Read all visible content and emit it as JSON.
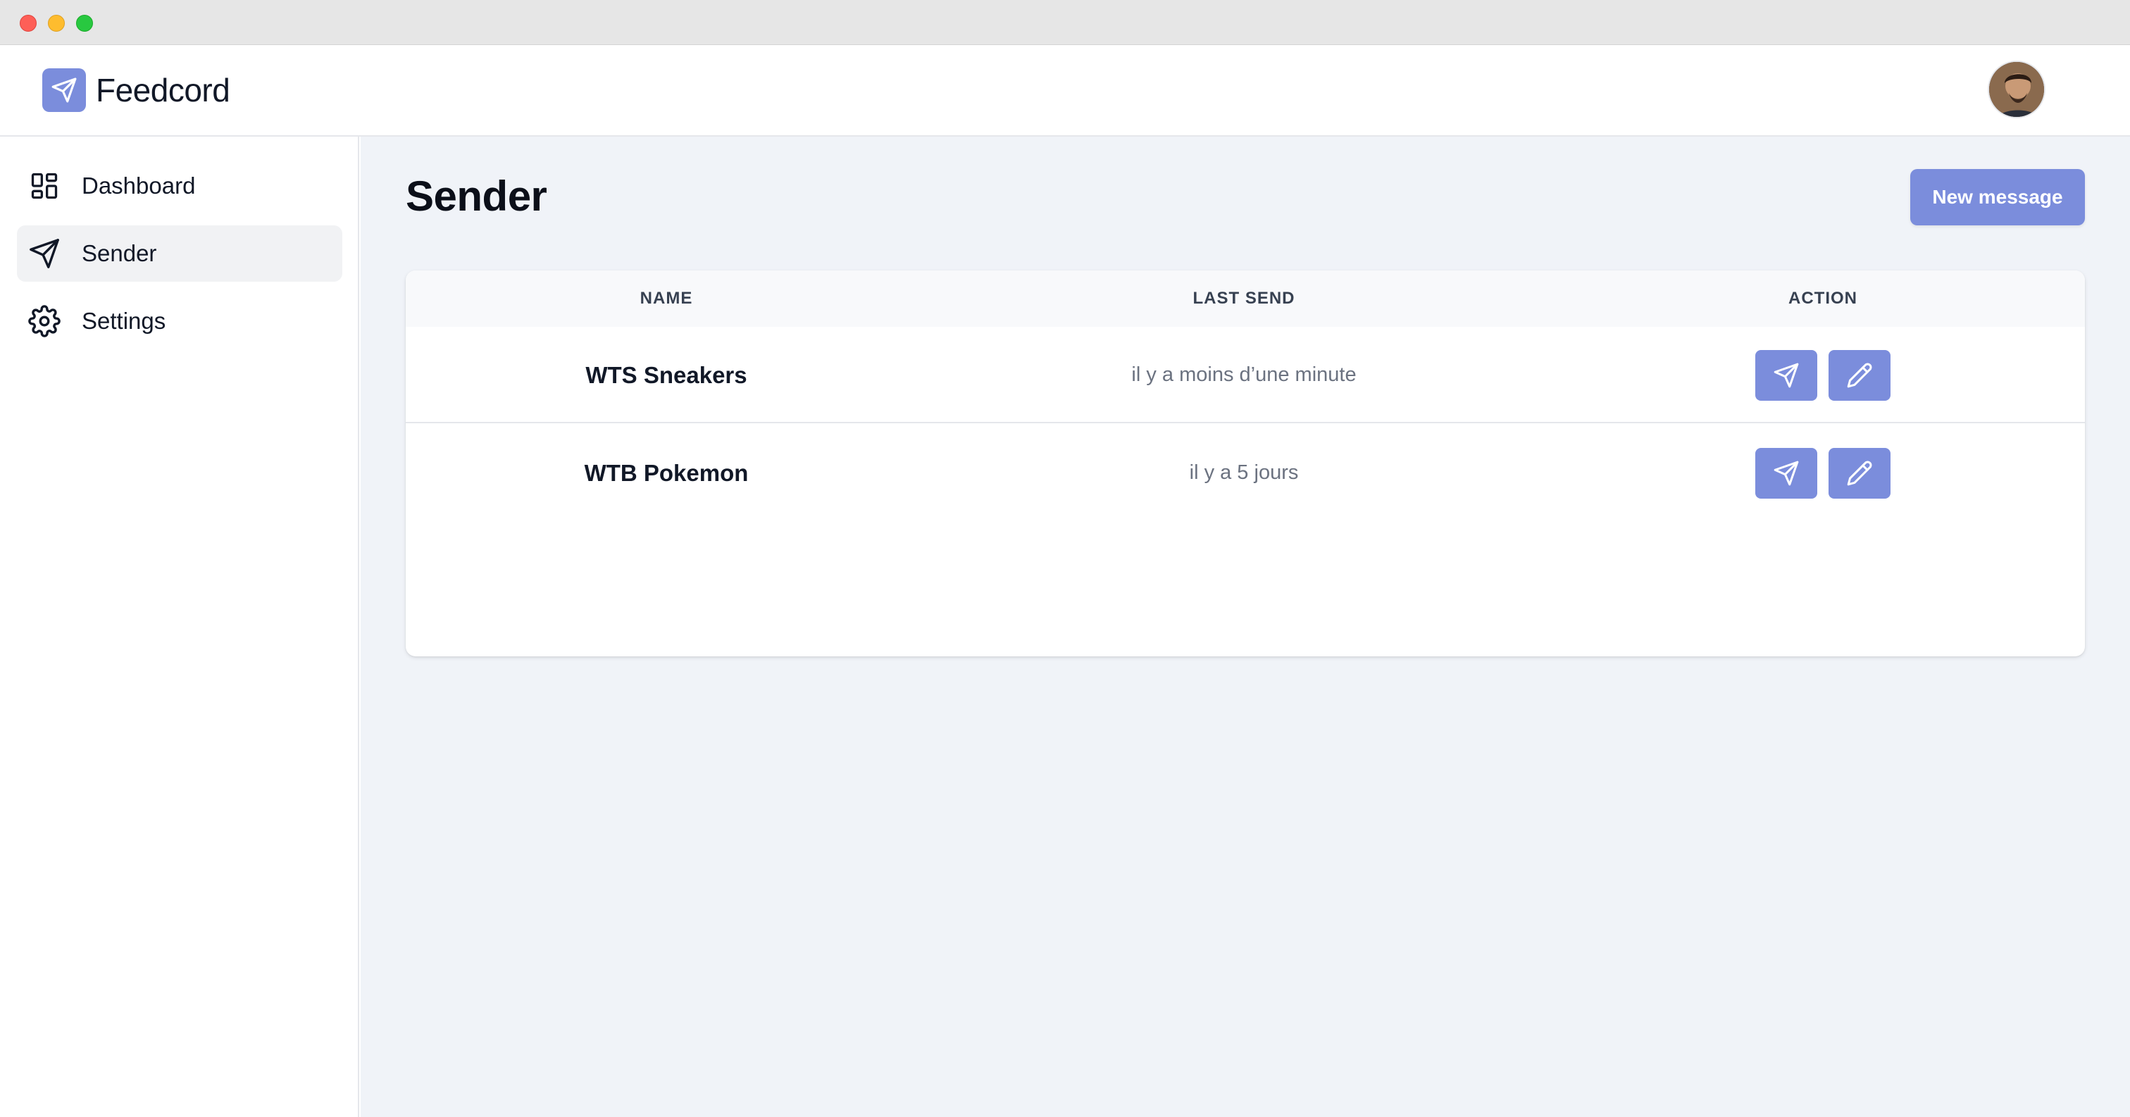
{
  "window": {
    "controls": [
      "close",
      "minimize",
      "maximize"
    ]
  },
  "header": {
    "brand_name": "Feedcord",
    "brand_icon": "paper-plane-icon",
    "avatar_icon": "user-avatar"
  },
  "sidebar": {
    "items": [
      {
        "label": "Dashboard",
        "icon": "dashboard-grid-icon",
        "active": false
      },
      {
        "label": "Sender",
        "icon": "paper-plane-icon",
        "active": true
      },
      {
        "label": "Settings",
        "icon": "gear-icon",
        "active": false
      }
    ]
  },
  "main": {
    "title": "Sender",
    "new_button_label": "New message",
    "table": {
      "columns": [
        "NAME",
        "LAST SEND",
        "ACTION"
      ],
      "rows": [
        {
          "name": "WTS Sneakers",
          "last_send": "il y a moins d’une minute"
        },
        {
          "name": "WTB Pokemon",
          "last_send": "il y a 5 jours"
        }
      ],
      "row_actions": [
        {
          "icon": "paper-plane-icon"
        },
        {
          "icon": "pencil-icon"
        }
      ]
    }
  },
  "colors": {
    "accent": "#7b8ddc",
    "main_background": "#f0f3f8",
    "sidebar_active": "#f1f2f4"
  }
}
